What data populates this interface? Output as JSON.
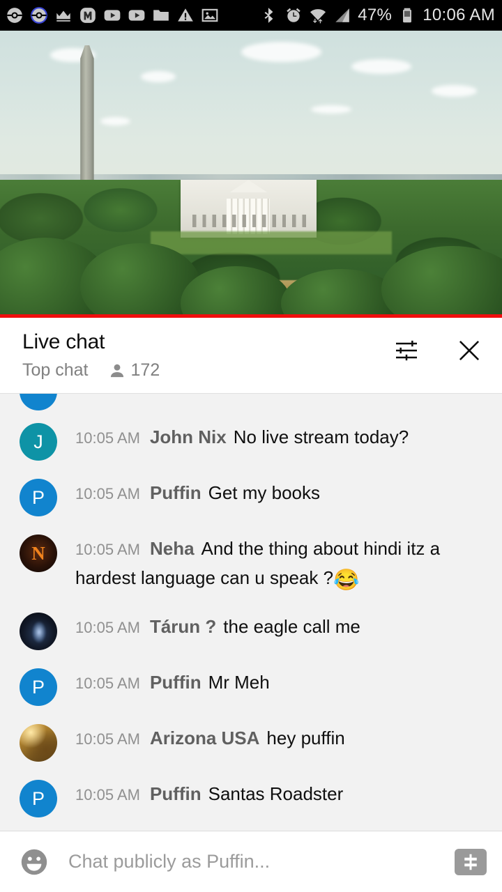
{
  "status_bar": {
    "left_icons": [
      "pokeball-icon",
      "pokeball-outline-icon",
      "crown-icon",
      "m-app-icon",
      "youtube-icon",
      "youtube-icon-2",
      "folder-icon",
      "warning-icon",
      "image-icon"
    ],
    "right_icons": [
      "bluetooth-icon",
      "alarm-icon",
      "wifi-icon",
      "signal-icon",
      "battery-icon"
    ],
    "battery_percent": "47%",
    "clock": "10:06 AM"
  },
  "video": {
    "scene": "Washington DC skyline with Washington Monument and the White House",
    "progress_color": "#f00d0d"
  },
  "chat": {
    "title": "Live chat",
    "mode": "Top chat",
    "viewer_count": "172",
    "settings_icon": "sliders-icon",
    "close_icon": "close-icon",
    "messages": [
      {
        "time": "10:05 AM",
        "author": "John Nix",
        "text": "No live stream today?",
        "avatar_letter": "J",
        "avatar_class": "av-j"
      },
      {
        "time": "10:05 AM",
        "author": "Puffin",
        "text": "Get my books",
        "avatar_letter": "P",
        "avatar_class": "av-p"
      },
      {
        "time": "10:05 AM",
        "author": "Neha",
        "text": "And the thing about hindi itz a hardest language can u speak ?",
        "emoji": "😂",
        "avatar_letter": "N",
        "avatar_class": "av-n"
      },
      {
        "time": "10:05 AM",
        "author": "Tárun ?",
        "text": "the eagle call me",
        "avatar_letter": "",
        "avatar_class": "av-t"
      },
      {
        "time": "10:05 AM",
        "author": "Puffin",
        "text": "Mr Meh",
        "avatar_letter": "P",
        "avatar_class": "av-p"
      },
      {
        "time": "10:05 AM",
        "author": "Arizona USA",
        "text": "hey puffin",
        "avatar_letter": "",
        "avatar_class": "av-az"
      },
      {
        "time": "10:05 AM",
        "author": "Puffin",
        "text": "Santas Roadster",
        "avatar_letter": "P",
        "avatar_class": "av-p"
      }
    ]
  },
  "composer": {
    "emoji_icon": "emoji-smiley-icon",
    "placeholder": "Chat publicly as Puffin...",
    "input_value": "",
    "superchat_icon": "dollar-icon"
  }
}
